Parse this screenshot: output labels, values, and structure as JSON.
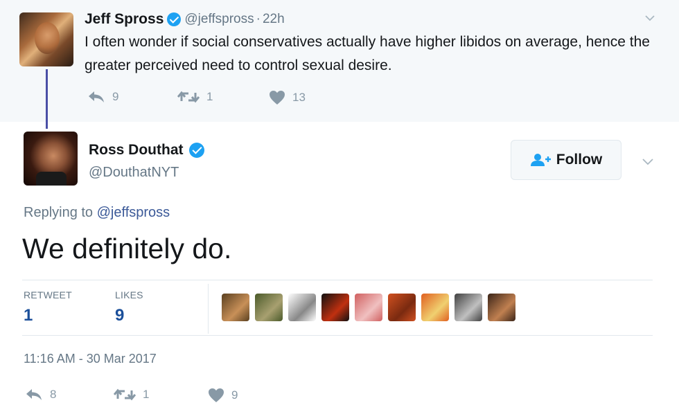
{
  "parent_tweet": {
    "name": "Jeff Spross",
    "handle": "@jeffspross",
    "separator": "·",
    "time": "22h",
    "text": "I often wonder if social conservatives actually have higher libidos on average, hence the greater perceived need to control sexual desire.",
    "reply_count": "9",
    "retweet_count": "1",
    "like_count": "13"
  },
  "main_tweet": {
    "name": "Ross Douthat",
    "handle": "@DouthatNYT",
    "follow_label": "Follow",
    "replying_prefix": "Replying to",
    "replying_handle": "@jeffspross",
    "text": "We definitely do.",
    "retweets_label": "RETWEET",
    "retweets_value": "1",
    "likes_label": "LIKES",
    "likes_value": "9",
    "timestamp": "11:16 AM - 30 Mar 2017",
    "reply_count": "8",
    "retweet_count": "1",
    "like_count": "9"
  },
  "colors": {
    "verified_blue": "#1da1f2",
    "thread_line": "#4a4fa6",
    "link": "#3b5998",
    "stat_value": "#1b4f9a",
    "muted": "#657786",
    "icon_gray": "#8899a6"
  },
  "icons": {
    "reply": "reply-icon",
    "retweet": "retweet-icon",
    "like": "heart-icon",
    "verified": "verified-badge-icon",
    "caret": "chevron-down-icon",
    "follow": "add-user-icon"
  },
  "likers": [
    {
      "colors": [
        "#5a4020",
        "#c89058"
      ]
    },
    {
      "colors": [
        "#4a5a2a",
        "#a8a070"
      ]
    },
    {
      "colors": [
        "#ffffff",
        "#888888"
      ]
    },
    {
      "colors": [
        "#111111",
        "#c03010"
      ]
    },
    {
      "colors": [
        "#d06060",
        "#f0c0c0"
      ]
    },
    {
      "colors": [
        "#d05020",
        "#7a2a10"
      ]
    },
    {
      "colors": [
        "#e06020",
        "#f0d070"
      ]
    },
    {
      "colors": [
        "#404040",
        "#c0c0c0"
      ]
    },
    {
      "colors": [
        "#3a2418",
        "#c08050"
      ]
    }
  ]
}
